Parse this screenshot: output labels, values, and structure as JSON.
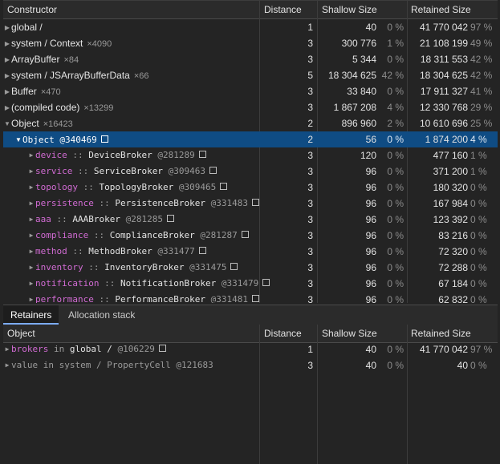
{
  "top_table": {
    "headers": {
      "name": "Constructor",
      "distance": "Distance",
      "shallow": "Shallow Size",
      "retained": "Retained Size"
    },
    "rows": [
      {
        "name": "global /",
        "count": "",
        "distance": "1",
        "shallow": "40",
        "shallow_pct": "0 %",
        "retained": "41 770 042",
        "retained_pct": "97 %"
      },
      {
        "name": "system / Context",
        "count": "×4090",
        "distance": "3",
        "shallow": "300 776",
        "shallow_pct": "1 %",
        "retained": "21 108 199",
        "retained_pct": "49 %"
      },
      {
        "name": "ArrayBuffer",
        "count": "×84",
        "distance": "3",
        "shallow": "5 344",
        "shallow_pct": "0 %",
        "retained": "18 311 553",
        "retained_pct": "42 %"
      },
      {
        "name": "system / JSArrayBufferData",
        "count": "×66",
        "distance": "5",
        "shallow": "18 304 625",
        "shallow_pct": "42 %",
        "retained": "18 304 625",
        "retained_pct": "42 %"
      },
      {
        "name": "Buffer",
        "count": "×470",
        "distance": "3",
        "shallow": "33 840",
        "shallow_pct": "0 %",
        "retained": "17 911 327",
        "retained_pct": "41 %"
      },
      {
        "name": "(compiled code)",
        "count": "×13299",
        "distance": "3",
        "shallow": "1 867 208",
        "shallow_pct": "4 %",
        "retained": "12 330 768",
        "retained_pct": "29 %"
      },
      {
        "name": "Object",
        "count": "×16423",
        "distance": "2",
        "shallow": "896 960",
        "shallow_pct": "2 %",
        "retained": "10 610 696",
        "retained_pct": "25 %"
      }
    ],
    "selected": {
      "name": "Object @340469",
      "distance": "2",
      "shallow": "56",
      "shallow_pct": "0 %",
      "retained": "1 874 200",
      "retained_pct": "4 %"
    },
    "children": [
      {
        "prop": "device",
        "sep": "::",
        "cls": "DeviceBroker",
        "id": "@281289",
        "distance": "3",
        "shallow": "120",
        "shallow_pct": "0 %",
        "retained": "477 160",
        "retained_pct": "1 %"
      },
      {
        "prop": "service",
        "sep": "::",
        "cls": "ServiceBroker",
        "id": "@309463",
        "distance": "3",
        "shallow": "96",
        "shallow_pct": "0 %",
        "retained": "371 200",
        "retained_pct": "1 %"
      },
      {
        "prop": "topology",
        "sep": "::",
        "cls": "TopologyBroker",
        "id": "@309465",
        "distance": "3",
        "shallow": "96",
        "shallow_pct": "0 %",
        "retained": "180 320",
        "retained_pct": "0 %"
      },
      {
        "prop": "persistence",
        "sep": "::",
        "cls": "PersistenceBroker",
        "id": "@331483",
        "distance": "3",
        "shallow": "96",
        "shallow_pct": "0 %",
        "retained": "167 984",
        "retained_pct": "0 %"
      },
      {
        "prop": "aaa",
        "sep": "::",
        "cls": "AAABroker",
        "id": "@281285",
        "distance": "3",
        "shallow": "96",
        "shallow_pct": "0 %",
        "retained": "123 392",
        "retained_pct": "0 %"
      },
      {
        "prop": "compliance",
        "sep": "::",
        "cls": "ComplianceBroker",
        "id": "@281287",
        "distance": "3",
        "shallow": "96",
        "shallow_pct": "0 %",
        "retained": "83 216",
        "retained_pct": "0 %"
      },
      {
        "prop": "method",
        "sep": "::",
        "cls": "MethodBroker",
        "id": "@331477",
        "distance": "3",
        "shallow": "96",
        "shallow_pct": "0 %",
        "retained": "72 320",
        "retained_pct": "0 %"
      },
      {
        "prop": "inventory",
        "sep": "::",
        "cls": "InventoryBroker",
        "id": "@331475",
        "distance": "3",
        "shallow": "96",
        "shallow_pct": "0 %",
        "retained": "72 288",
        "retained_pct": "0 %"
      },
      {
        "prop": "notification",
        "sep": "::",
        "cls": "NotificationBroker",
        "id": "@331479",
        "distance": "3",
        "shallow": "96",
        "shallow_pct": "0 %",
        "retained": "67 184",
        "retained_pct": "0 %"
      },
      {
        "prop": "performance",
        "sep": "::",
        "cls": "PerformanceBroker",
        "id": "@331481",
        "distance": "3",
        "shallow": "96",
        "shallow_pct": "0 %",
        "retained": "62 832",
        "retained_pct": "0 %"
      }
    ]
  },
  "tabs": {
    "retainers": "Retainers",
    "allocation_stack": "Allocation stack"
  },
  "bottom_table": {
    "headers": {
      "name": "Object",
      "distance": "Distance",
      "shallow": "Shallow Size",
      "retained": "Retained Size"
    },
    "rows": [
      {
        "prop": "brokers",
        "word": "in",
        "target": "global /",
        "id": "@106229",
        "distance": "1",
        "shallow": "40",
        "shallow_pct": "0 %",
        "retained": "41 770 042",
        "retained_pct": "97 %"
      },
      {
        "prop": "value",
        "word": "in",
        "target": "system / PropertyCell",
        "id": "@121683",
        "distance": "3",
        "shallow": "40",
        "shallow_pct": "0 %",
        "retained": "40",
        "retained_pct": "0 %"
      }
    ]
  },
  "colors": {
    "selected_row": "#0f4c84",
    "property": "#d06bd2",
    "active_tab_underline": "#7cacf8"
  },
  "icons": {
    "expand": "triangle-right-icon",
    "collapse": "triangle-down-icon",
    "reveal": "square-icon"
  }
}
